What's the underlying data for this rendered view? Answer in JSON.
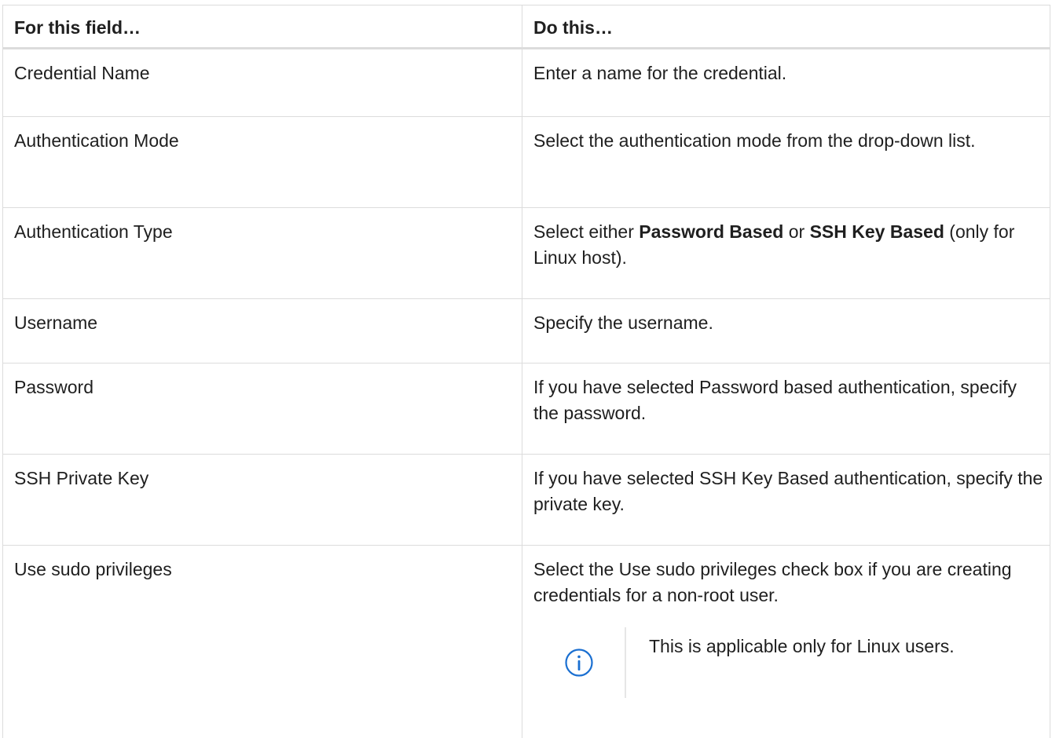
{
  "table": {
    "headers": [
      "For this field…",
      "Do this…"
    ],
    "rows": [
      {
        "field": "Credential Name",
        "action": "Enter a name for the credential."
      },
      {
        "field": "Authentication Mode",
        "action": "Select the authentication mode from the drop-down list."
      },
      {
        "field": "Authentication Type",
        "action_prefix": "Select either ",
        "action_bold1": "Password Based",
        "action_mid": " or ",
        "action_bold2": "SSH Key Based",
        "action_suffix": " (only for Linux host)."
      },
      {
        "field": "Username",
        "action": "Specify the username."
      },
      {
        "field": "Password",
        "action": "If you have selected Password based authentication, specify the password."
      },
      {
        "field": "SSH Private Key",
        "action": "If you have selected SSH Key Based authentication, specify the private key."
      },
      {
        "field": "Use sudo privileges",
        "action": "Select the Use sudo privileges check box if you are creating credentials for a non-root user."
      }
    ],
    "note": {
      "icon": "info-icon",
      "text": "This is applicable only for Linux users."
    }
  },
  "colors": {
    "border": "#dcdcdc",
    "icon": "#1a6fd1",
    "text": "#1f1f1f"
  }
}
